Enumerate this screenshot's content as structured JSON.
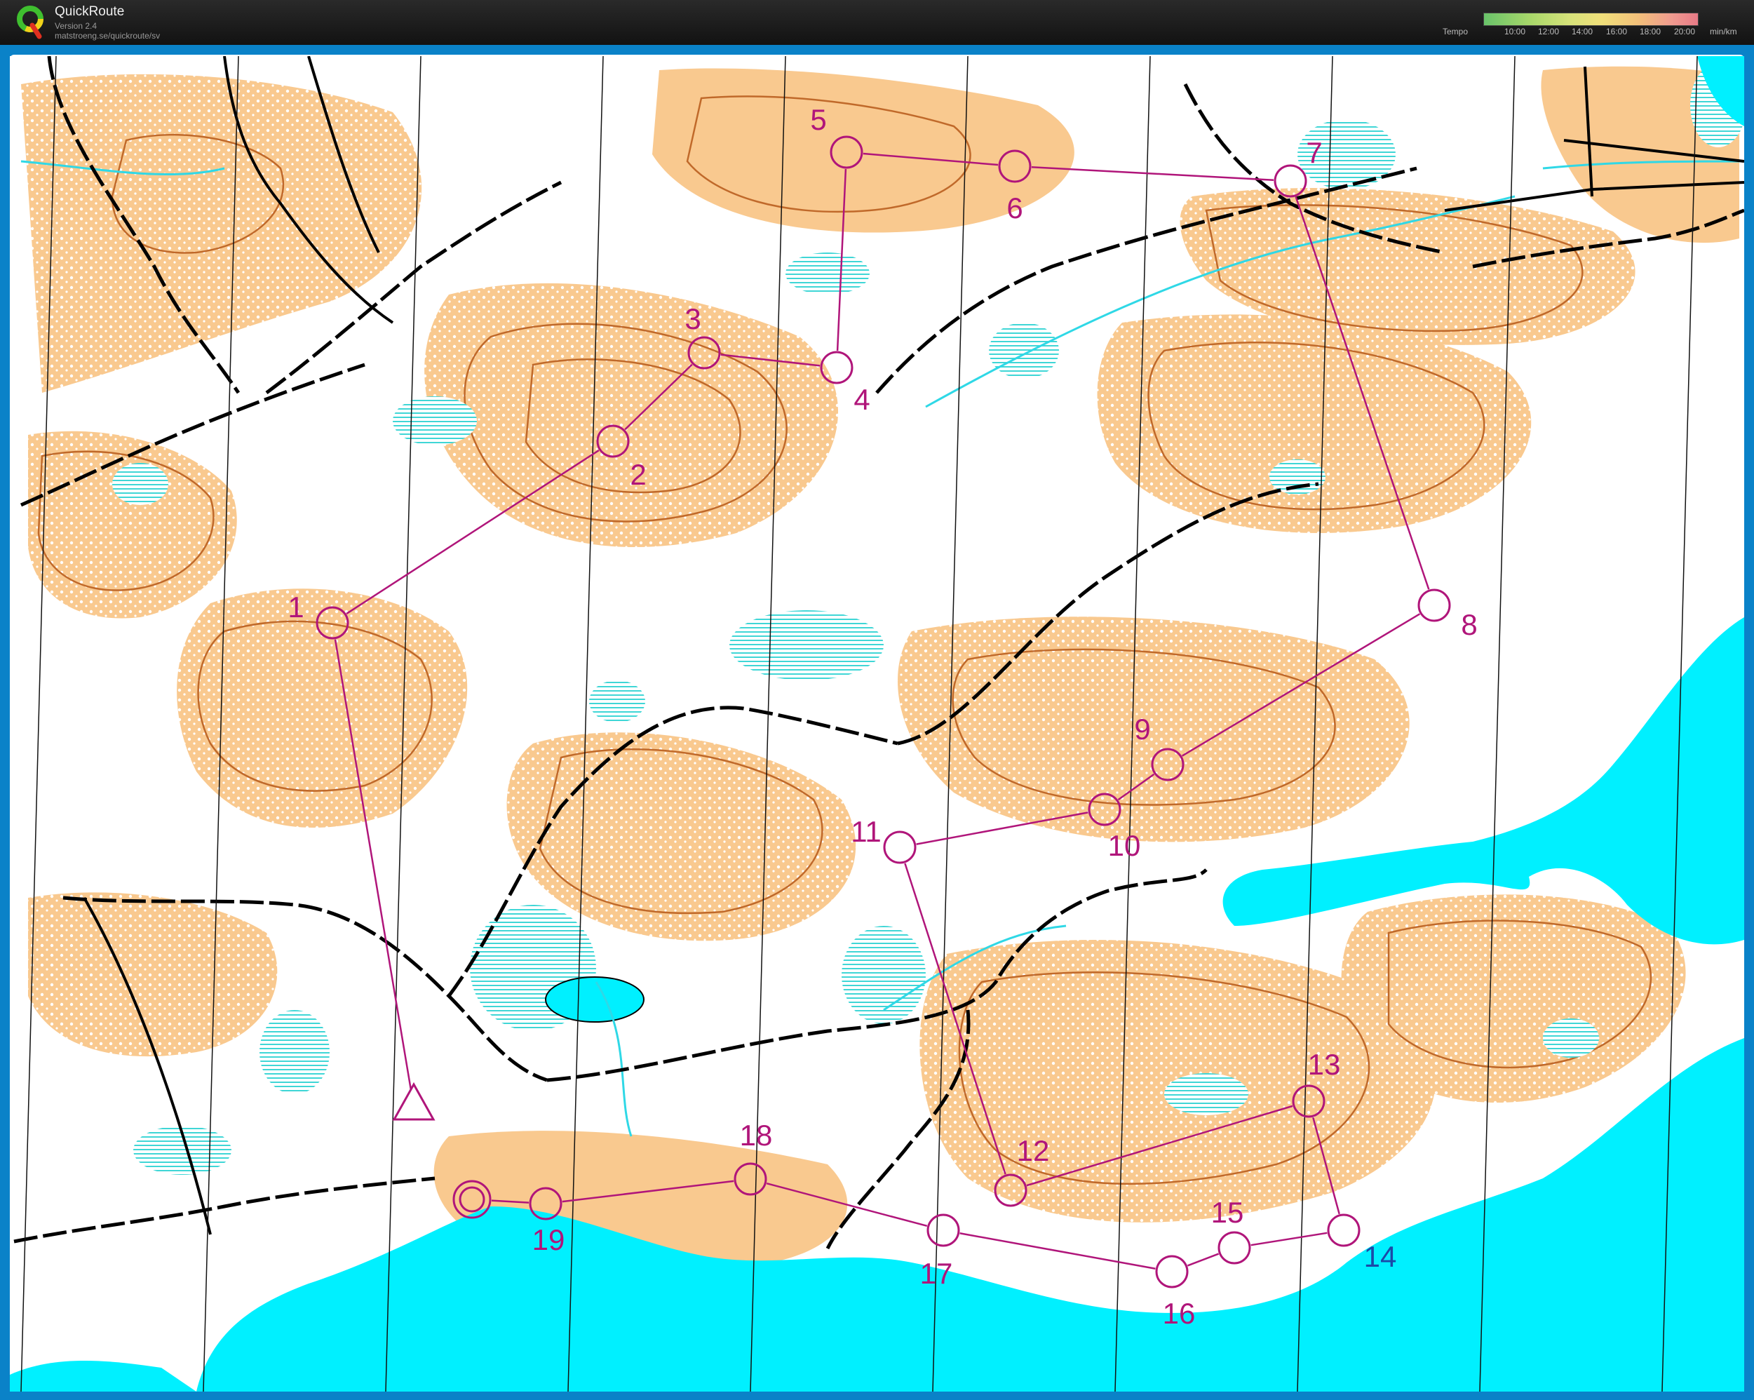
{
  "app": {
    "title": "QuickRoute",
    "version": "Version 2.4",
    "url": "matstroeng.se/quickroute/sv"
  },
  "tempo_legend": {
    "label": "Tempo",
    "ticks": [
      "10:00",
      "12:00",
      "14:00",
      "16:00",
      "18:00",
      "20:00"
    ],
    "unit": "min/km"
  },
  "colors": {
    "course": "#b0157a",
    "water": "#00f0ff",
    "terrain_open": "#f9c98f",
    "contour": "#c0692a",
    "frame": "#0a82c8"
  },
  "course": {
    "start_symbol": "triangle",
    "finish_symbol": "double-circle",
    "controls": [
      {
        "label": "1",
        "num_color": "#b0157a"
      },
      {
        "label": "2",
        "num_color": "#b0157a"
      },
      {
        "label": "3",
        "num_color": "#b0157a"
      },
      {
        "label": "4",
        "num_color": "#b0157a"
      },
      {
        "label": "5",
        "num_color": "#b0157a"
      },
      {
        "label": "6",
        "num_color": "#b0157a"
      },
      {
        "label": "7",
        "num_color": "#b0157a"
      },
      {
        "label": "8",
        "num_color": "#b0157a"
      },
      {
        "label": "9",
        "num_color": "#b0157a"
      },
      {
        "label": "10",
        "num_color": "#b0157a"
      },
      {
        "label": "11",
        "num_color": "#b0157a"
      },
      {
        "label": "12",
        "num_color": "#b0157a"
      },
      {
        "label": "13",
        "num_color": "#b0157a"
      },
      {
        "label": "14",
        "num_color": "#1b4aa8"
      },
      {
        "label": "15",
        "num_color": "#b0157a"
      },
      {
        "label": "16",
        "num_color": "#b0157a"
      },
      {
        "label": "17",
        "num_color": "#b0157a"
      },
      {
        "label": "18",
        "num_color": "#b0157a"
      },
      {
        "label": "19",
        "num_color": "#b0157a"
      }
    ]
  }
}
